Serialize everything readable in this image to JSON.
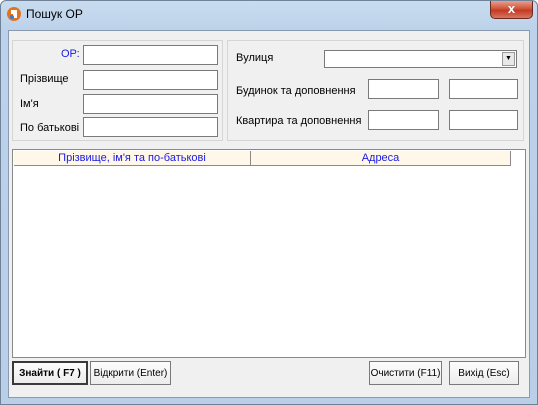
{
  "window": {
    "title": "Пошук ОР",
    "close_label": "x"
  },
  "search": {
    "or_label": "ОР:",
    "surname_label": "Прізвище",
    "name_label": "Ім'я",
    "patronymic_label": "По батькові",
    "or_value": "",
    "surname_value": "",
    "name_value": "",
    "patronymic_value": ""
  },
  "address": {
    "street_label": "Вулиця",
    "street_value": "",
    "house_label": "Будинок та доповнення",
    "house_value": "",
    "house_suffix_value": "",
    "apartment_label": "Квартира та доповнення",
    "apartment_value": "",
    "apartment_suffix_value": ""
  },
  "results": {
    "columns": [
      "Прізвище, ім'я та по-батькові",
      "Адреса"
    ],
    "rows": []
  },
  "buttons": {
    "find": "Знайти ( F7 )",
    "open": "Відкрити (Enter)",
    "clear": "Очистити (F11)",
    "exit": "Вихід (Esc)"
  },
  "icons": {
    "app": "app-icon",
    "dropdown": "chevron-down-icon"
  },
  "colors": {
    "label_accent": "#1a1ae0",
    "header_bg": "#fff7e8",
    "close_red": "#c23a22"
  }
}
